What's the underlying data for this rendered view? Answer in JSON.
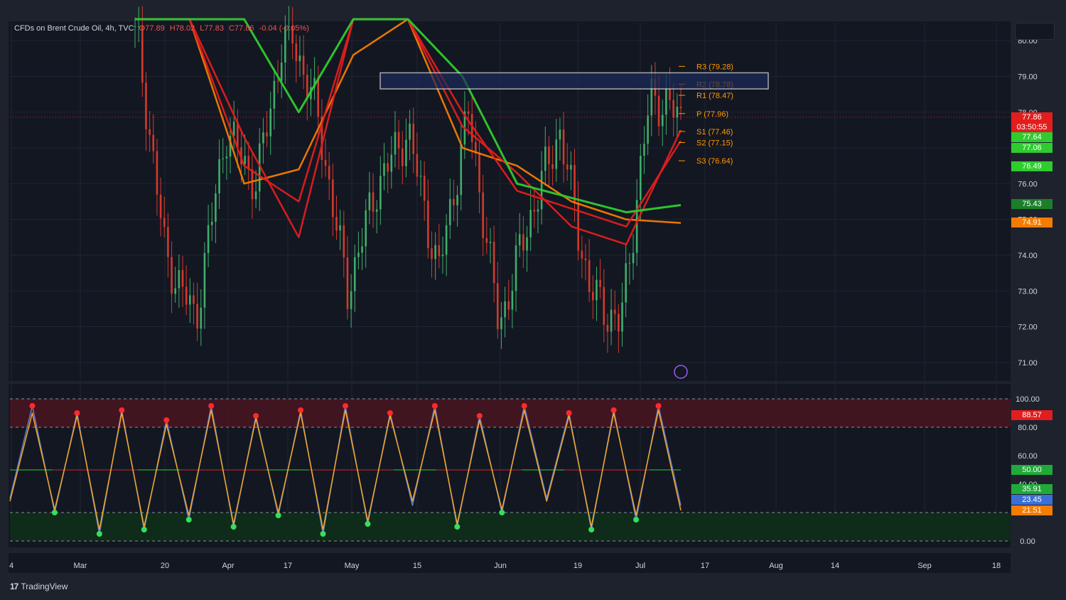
{
  "header": {
    "symbol": "CFDs on Brent Crude Oil, 4h, TVC",
    "open": "O77.89",
    "high": "H78.02",
    "low": "L77.83",
    "close": "C77.86",
    "change": "-0.04 (-0.05%)"
  },
  "brand": {
    "logo": "tradingview-logo",
    "name": "TradingView"
  },
  "colors": {
    "background": "#131722",
    "bull": "#26a69a",
    "bear": "#ef5350",
    "ma_red": "#e31d1d",
    "ma_green": "#2ecc2e",
    "ma_orange": "#f57c00",
    "stoch_blue": "#5b7fd6",
    "stoch_orange": "#f5a623",
    "pivot": "#ff9800"
  },
  "price_axis": {
    "ticks": [
      "80.00",
      "79.00",
      "78.00",
      "77.00",
      "76.00",
      "75.00",
      "74.00",
      "73.00",
      "72.00",
      "71.00"
    ],
    "labels": [
      {
        "text": "77.86",
        "color": "#e31d1d",
        "value": 77.86
      },
      {
        "text": "03:50:55",
        "color": "#e31d1d",
        "value": 77.58
      },
      {
        "text": "77.64",
        "color": "#2ecc2e",
        "value": 77.3
      },
      {
        "text": "77.06",
        "color": "#2ecc2e",
        "value": 77.0
      },
      {
        "text": "76.49",
        "color": "#2ecc2e",
        "value": 76.49
      },
      {
        "text": "75.43",
        "color": "#1b7f2a",
        "value": 75.43
      },
      {
        "text": "74.91",
        "color": "#f57c00",
        "value": 74.91
      }
    ]
  },
  "osc_axis": {
    "ticks": [
      "100.00",
      "80.00",
      "60.00",
      "40.00",
      "20.00",
      "0.00"
    ],
    "labels": [
      {
        "text": "88.57",
        "color": "#e31d1d",
        "value": 88.57
      },
      {
        "text": "50.00",
        "color": "#1faa3a",
        "value": 50
      },
      {
        "text": "35.91",
        "color": "#1faa3a",
        "value": 36.5
      },
      {
        "text": "23.45",
        "color": "#3b6fd6",
        "value": 29
      },
      {
        "text": "21.51",
        "color": "#f57c00",
        "value": 21.5
      }
    ]
  },
  "time_axis": [
    "4",
    "Mar",
    "20",
    "Apr",
    "17",
    "May",
    "15",
    "Jun",
    "19",
    "Jul",
    "17",
    "Aug",
    "14",
    "Sep",
    "18"
  ],
  "pivots": [
    {
      "label": "R3 (79.28)",
      "value": 79.28
    },
    {
      "label": "R2 (78.78)",
      "value": 78.78
    },
    {
      "label": "R1 (78.47)",
      "value": 78.47
    },
    {
      "label": "P (77.96)",
      "value": 77.96
    },
    {
      "label": "S1 (77.46)",
      "value": 77.46
    },
    {
      "label": "S2 (77.15)",
      "value": 77.15
    },
    {
      "label": "S3 (76.64)",
      "value": 76.64
    }
  ],
  "zone": {
    "from": 78.65,
    "to": 79.1
  },
  "chart_data": [
    {
      "type": "line",
      "title": "CFDs on Brent Crude Oil, 4h, TVC",
      "xlabel": "",
      "ylabel": "",
      "ylim": [
        70.5,
        80.5
      ],
      "x": [
        "4",
        "Mar",
        "20",
        "Apr",
        "17",
        "May",
        "15",
        "Jun",
        "19",
        "Jul"
      ],
      "series": [
        {
          "values": [
            80.6,
            80.6,
            76.0,
            76.4,
            79.6,
            80.6,
            77.0,
            76.5,
            75.5,
            75.0,
            74.9
          ]
        },
        {
          "values": [
            80.6,
            80.6,
            77.3,
            74.5,
            80.6,
            80.6,
            78.0,
            75.8,
            75.3,
            74.8,
            77.2
          ]
        },
        {
          "values": [
            80.6,
            80.6,
            76.5,
            75.5,
            80.6,
            80.6,
            77.6,
            76.3,
            74.8,
            74.3,
            77.5
          ]
        },
        {
          "values": [
            80.6,
            80.6,
            80.6,
            78.0,
            80.6,
            80.6,
            79.0,
            76.0,
            75.6,
            75.2,
            75.4
          ]
        }
      ],
      "price": [
        80.6,
        74.0,
        72.2,
        77.5,
        76.0,
        80.6,
        78.0,
        73.0,
        76.0,
        77.5,
        73.5,
        78.0,
        72.0,
        75.0,
        77.5,
        73.0,
        72.0,
        78.5,
        77.86
      ],
      "last": 77.86,
      "grid": true,
      "legend": "none"
    },
    {
      "type": "line",
      "ylim": [
        0,
        100
      ],
      "bands": [
        [
          80,
          100
        ],
        [
          0,
          20
        ]
      ],
      "series": [
        {
          "values": [
            30,
            95,
            20,
            90,
            5,
            92,
            8,
            85,
            15,
            95,
            10,
            88,
            18,
            92,
            5,
            95,
            12,
            90,
            25,
            95,
            10,
            88,
            20,
            95,
            30,
            90,
            8,
            92,
            15,
            95,
            25
          ]
        },
        {
          "values": [
            28,
            90,
            22,
            88,
            8,
            90,
            10,
            82,
            18,
            92,
            12,
            86,
            20,
            90,
            8,
            92,
            14,
            88,
            28,
            92,
            12,
            85,
            22,
            92,
            28,
            88,
            10,
            90,
            18,
            92,
            21.5
          ]
        }
      ],
      "levels": [
        50,
        80,
        20
      ]
    }
  ]
}
